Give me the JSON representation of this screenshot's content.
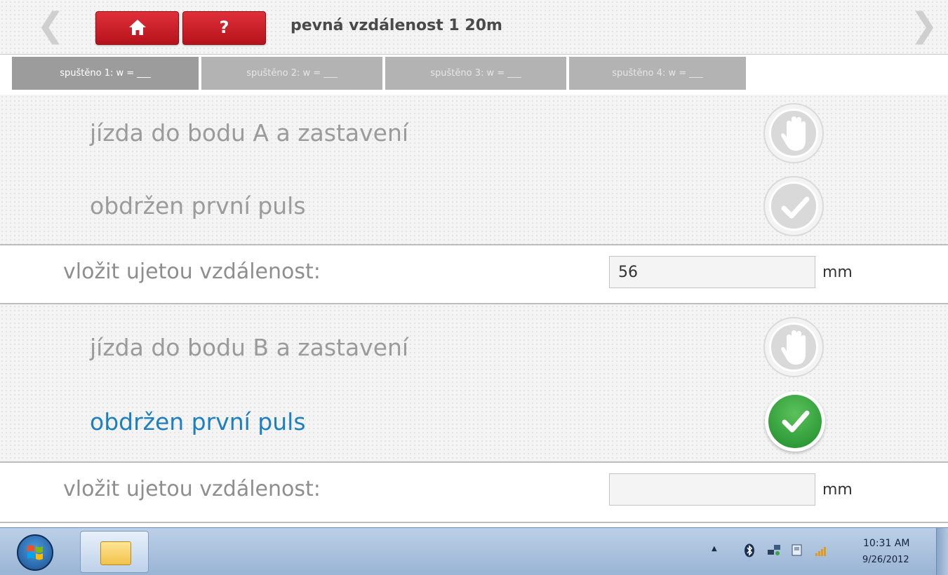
{
  "header": {
    "back_glyph": "❮",
    "forward_glyph": "❯",
    "help_label": "?",
    "title": "pevná vzdálenost 1 20m"
  },
  "tabs": [
    {
      "label": "spuštěno 1: w = ___",
      "active": true
    },
    {
      "label": "spuštěno 2: w = ___",
      "active": false
    },
    {
      "label": "spuštěno 3: w = ___",
      "active": false
    },
    {
      "label": "spuštěno 4: w = ___",
      "active": false
    }
  ],
  "run_a": {
    "step1_label": "jízda do bodu A a zastavení",
    "step1_icon": "hand-icon",
    "step2_label": "obdržen první puls",
    "step2_icon": "check-icon",
    "input_label": "vložit ujetou vzdálenost:",
    "input_value": "56",
    "unit": "mm"
  },
  "run_b": {
    "step1_label": "jízda do bodu B a zastavení",
    "step1_icon": "hand-icon",
    "step2_label": "obdržen první puls",
    "step2_icon": "check-icon",
    "input_label": "vložit ujetou vzdálenost:",
    "input_value": "",
    "unit": "mm"
  },
  "colors": {
    "active_text": "#1c7fbf",
    "inactive_text": "#9b9b9b",
    "red_button": "#c81e27",
    "green_check": "#2e9d3a"
  },
  "taskbar": {
    "tray_arrow": "▲",
    "clock_time": "10:31 AM",
    "clock_date": "9/26/2012"
  }
}
